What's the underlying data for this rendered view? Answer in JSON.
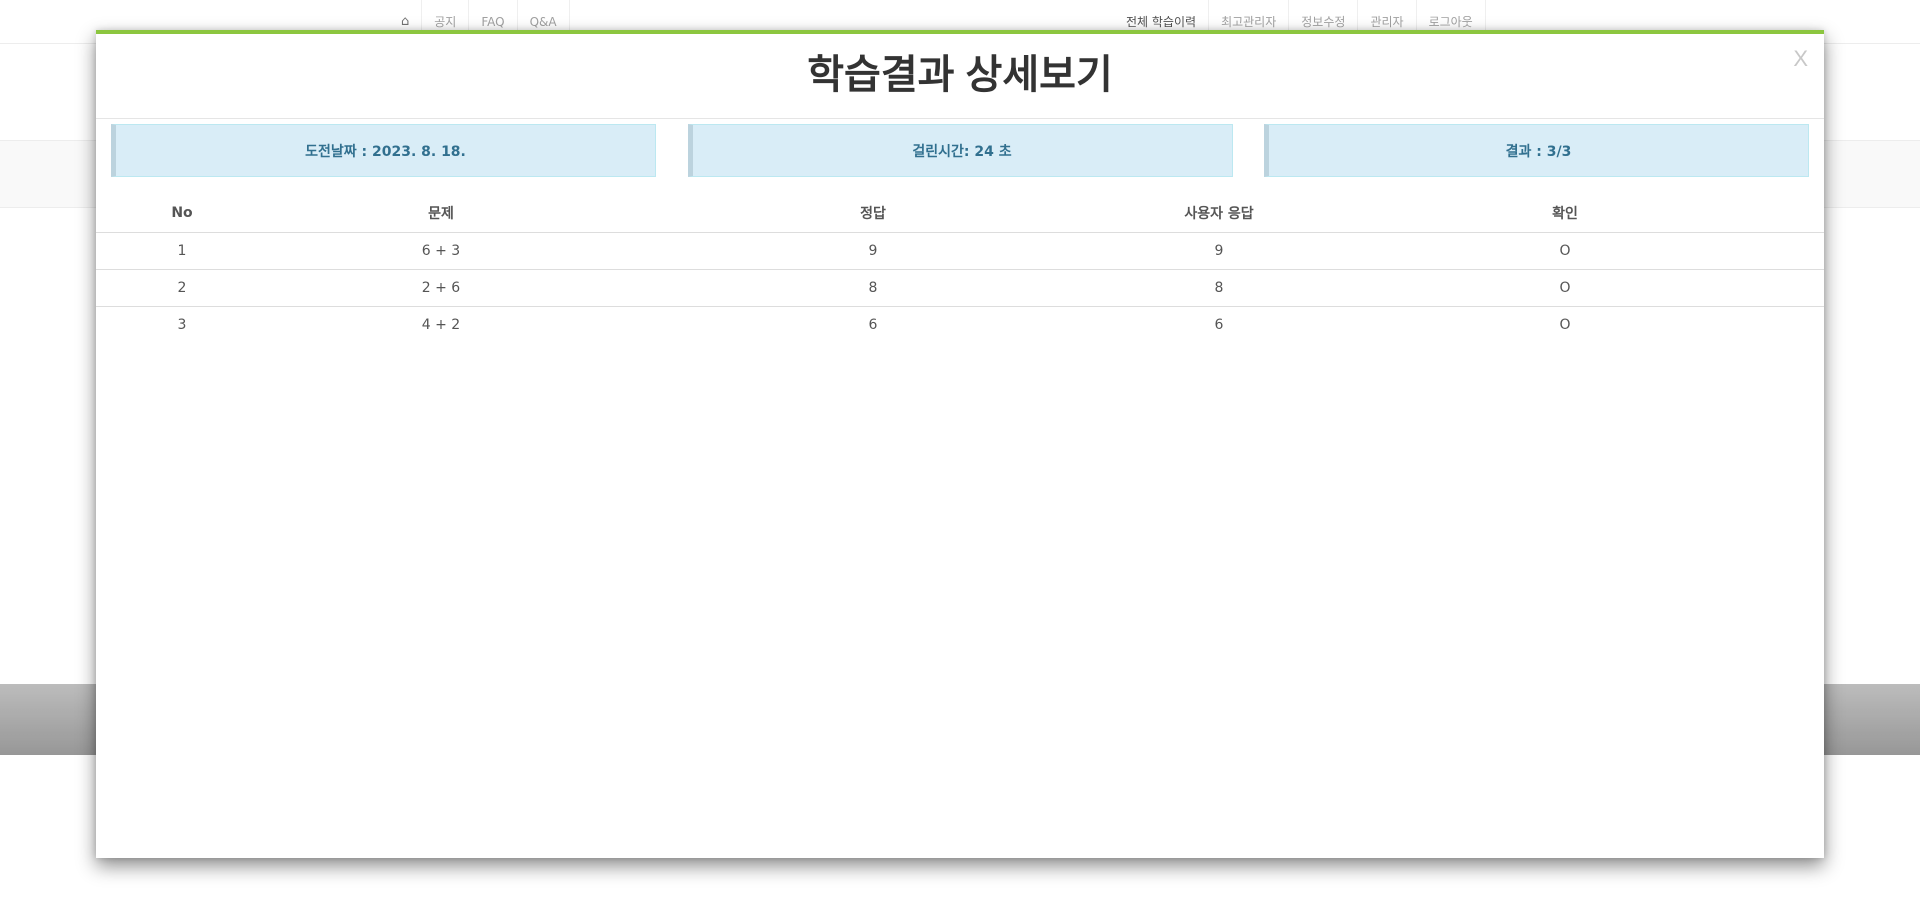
{
  "nav": {
    "left": [
      {
        "icon": "home-icon"
      },
      {
        "label": "공지"
      },
      {
        "label": "FAQ"
      },
      {
        "label": "Q&A"
      }
    ],
    "right": [
      {
        "label": "전체 학습이력"
      },
      {
        "label": "최고관리자"
      },
      {
        "label": "정보수정"
      },
      {
        "label": "관리자"
      },
      {
        "label": "로그아웃"
      }
    ]
  },
  "modal": {
    "title": "학습결과 상세보기",
    "close": "X",
    "info": {
      "date": "도전날짜 : 2023. 8. 18.",
      "time": "걸린시간: 24 초",
      "result": "결과 : 3/3"
    },
    "table": {
      "headers": [
        "No",
        "문제",
        "정답",
        "사용자 응답",
        "확인"
      ],
      "rows": [
        [
          "1",
          "6 + 3",
          "9",
          "9",
          "O"
        ],
        [
          "2",
          "2 + 6",
          "8",
          "8",
          "O"
        ],
        [
          "3",
          "4 + 2",
          "6",
          "6",
          "O"
        ]
      ]
    }
  },
  "colors": {
    "accent_top_border": "#8cc63f",
    "info_box_bg": "#d9edf7",
    "info_box_text": "#31708f"
  }
}
